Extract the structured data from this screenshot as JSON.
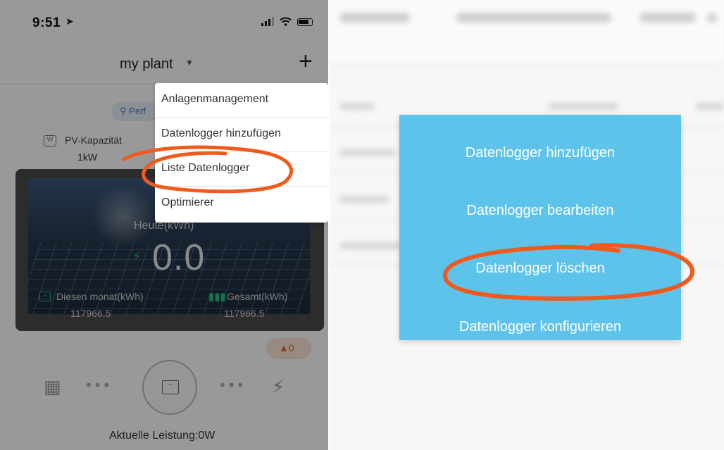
{
  "left_screen": {
    "status_bar": {
      "time": "9:51"
    },
    "nav": {
      "title": "my plant",
      "add_label": "+"
    },
    "status_chip": "Perf",
    "capacity": {
      "label": "PV-Kapazität",
      "value": "1kW"
    },
    "today": {
      "label": "Heute(kWh)",
      "value": "0.0"
    },
    "month": {
      "label": "Diesen monat(kWh)",
      "value": "117966.5"
    },
    "total": {
      "label": "Gesamt(kWh)",
      "value": "117966.5"
    },
    "alarm_count": "0",
    "current_power": "Aktuelle Leistung:0W",
    "dropdown_menu": {
      "items": [
        {
          "label": "Anlagenmanagement"
        },
        {
          "label": "Datenlogger hinzufügen"
        },
        {
          "label": "Liste Datenlogger"
        },
        {
          "label": "Optimierer"
        }
      ],
      "highlighted_index": 2
    }
  },
  "right_screen": {
    "action_menu": {
      "items": [
        {
          "label": "Datenlogger hinzufügen"
        },
        {
          "label": "Datenlogger bearbeiten"
        },
        {
          "label": "Datenlogger löschen"
        },
        {
          "label": "Datenlogger konfigurieren"
        }
      ],
      "highlighted_index": 2
    }
  },
  "colors": {
    "annotation": "#f05a1c",
    "action_menu_bg": "#5ec3ea",
    "accent_green": "#27c07e",
    "chip_blue": "#4a7ad0",
    "alarm_orange": "#e06d2a"
  }
}
